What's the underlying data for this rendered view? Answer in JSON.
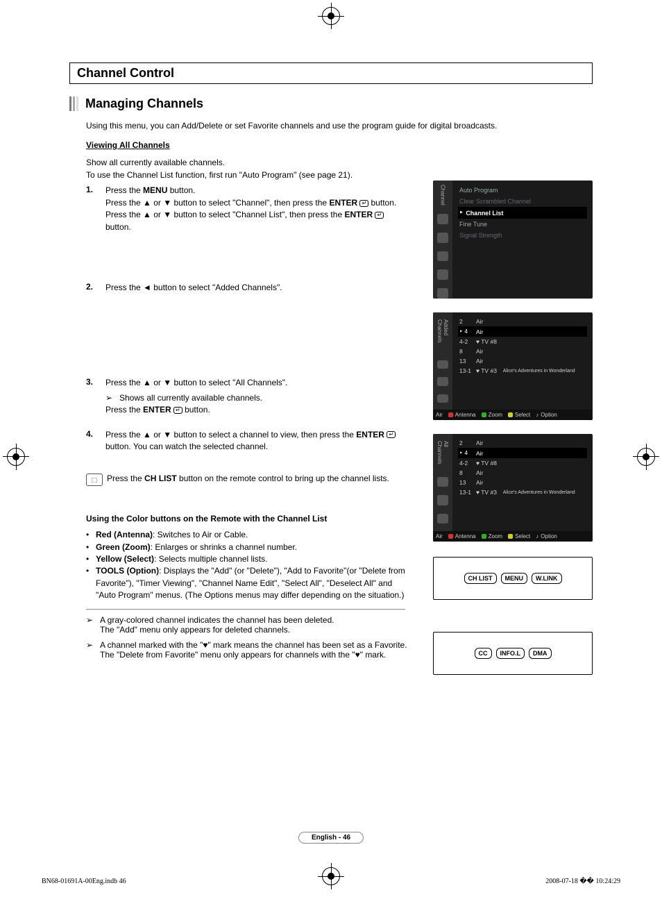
{
  "section_title": "Channel Control",
  "subsection_title": "Managing Channels",
  "intro": "Using this menu, you can Add/Delete or set Favorite channels and use the program guide for digital broadcasts.",
  "viewing_head": "Viewing All Channels",
  "viewing_p1": "Show all currently available channels.",
  "viewing_p2": "To use the Channel List function, first run \"Auto Program\" (see page 21).",
  "steps": {
    "s1_num": "1.",
    "s1_line1_a": "Press the ",
    "s1_line1_b": "MENU",
    "s1_line1_c": " button.",
    "s1_line2_a": "Press the ▲ or ▼ button to select \"Channel\", then press the ",
    "s1_line2_b": "ENTER",
    "s1_line2_c": " button.",
    "s1_line3_a": "Press the ▲ or ▼ button to select \"Channel List\", then press the ",
    "s1_line3_b": "ENTER",
    "s1_line3_c": " button.",
    "s2_num": "2.",
    "s2_line": "Press the ◄ button to select \"Added Channels\".",
    "s3_num": "3.",
    "s3_line": "Press the ▲ or ▼ button to select \"All Channels\".",
    "s3_note": "Shows all currently available channels.",
    "s3_line2_a": "Press the ",
    "s3_line2_b": "ENTER",
    "s3_line2_c": " button.",
    "s4_num": "4.",
    "s4_line_a": "Press the ▲ or ▼ button to select a channel to view, then press the ",
    "s4_line_b": "ENTER",
    "s4_line_c": " button. You can watch the selected channel."
  },
  "remote_tip_a": "Press the ",
  "remote_tip_b": "CH LIST",
  "remote_tip_c": " button on the remote control to bring up the channel lists.",
  "color_head": "Using the Color buttons on the Remote with the Channel List",
  "bullets": {
    "red_a": "Red (Antenna)",
    "red_b": ": Switches to Air or Cable.",
    "green_a": "Green (Zoom)",
    "green_b": ": Enlarges or shrinks a channel number.",
    "yellow_a": "Yellow (Select)",
    "yellow_b": ": Selects multiple channel lists.",
    "tools_a": "TOOLS (Option)",
    "tools_b": ": Displays the \"Add\" (or \"Delete\"), \"Add to Favorite\"(or \"Delete from Favorite\"), \"Timer Viewing\", \"Channel Name Edit\", \"Select All\", \"Deselect All\" and \"Auto Program\" menus. (The Options menus may differ depending on the situation.)"
  },
  "tail1a": "A gray-colored channel indicates the channel has been deleted.",
  "tail1b": "The \"Add\" menu only appears for deleted channels.",
  "tail2a": "A channel marked with the \"♥\" mark means the channel has been set as a Favorite.",
  "tail2b": "The \"Delete from Favorite\" menu only appears for channels with the \"♥\" mark.",
  "osd_menu": {
    "tab": "Channel",
    "items": [
      "Auto Program",
      "Clear Scrambled Channel",
      "Channel List",
      "Fine Tune",
      "Signal Strength"
    ]
  },
  "osd_added": {
    "tab": "Added Channels",
    "rows": [
      {
        "num": "2",
        "name": "Air",
        "extra": ""
      },
      {
        "num": "4",
        "name": "Air",
        "extra": ""
      },
      {
        "num": "4-2",
        "name": "♥ TV #8",
        "extra": ""
      },
      {
        "num": "8",
        "name": "Air",
        "extra": ""
      },
      {
        "num": "13",
        "name": "Air",
        "extra": ""
      },
      {
        "num": "13-1",
        "name": "♥ TV #3",
        "extra": "Alice's Adventures in Wonderland"
      }
    ],
    "footer": {
      "left": "Air",
      "antenna": "Antenna",
      "zoom": "Zoom",
      "select": "Select",
      "option": "Option"
    }
  },
  "osd_all": {
    "tab": "All Channels",
    "rows": [
      {
        "num": "2",
        "name": "Air",
        "extra": ""
      },
      {
        "num": "4",
        "name": "Air",
        "extra": ""
      },
      {
        "num": "4-2",
        "name": "♥ TV #8",
        "extra": ""
      },
      {
        "num": "8",
        "name": "Air",
        "extra": ""
      },
      {
        "num": "13",
        "name": "Air",
        "extra": ""
      },
      {
        "num": "13-1",
        "name": "♥ TV #3",
        "extra": "Alice's Adventures in Wonderland"
      }
    ],
    "footer": {
      "left": "Air",
      "antenna": "Antenna",
      "zoom": "Zoom",
      "select": "Select",
      "option": "Option"
    }
  },
  "remote1": {
    "b1": "CH LIST",
    "b2": "MENU",
    "b3": "W.LINK"
  },
  "remote2": {
    "b1": "CC",
    "b2": "INFO.L",
    "b3": "DMA"
  },
  "page_foot": "English - 46",
  "imprint_left": "BN68-01691A-00Eng.indb   46",
  "imprint_right": "2008-07-18   �� 10:24:29"
}
